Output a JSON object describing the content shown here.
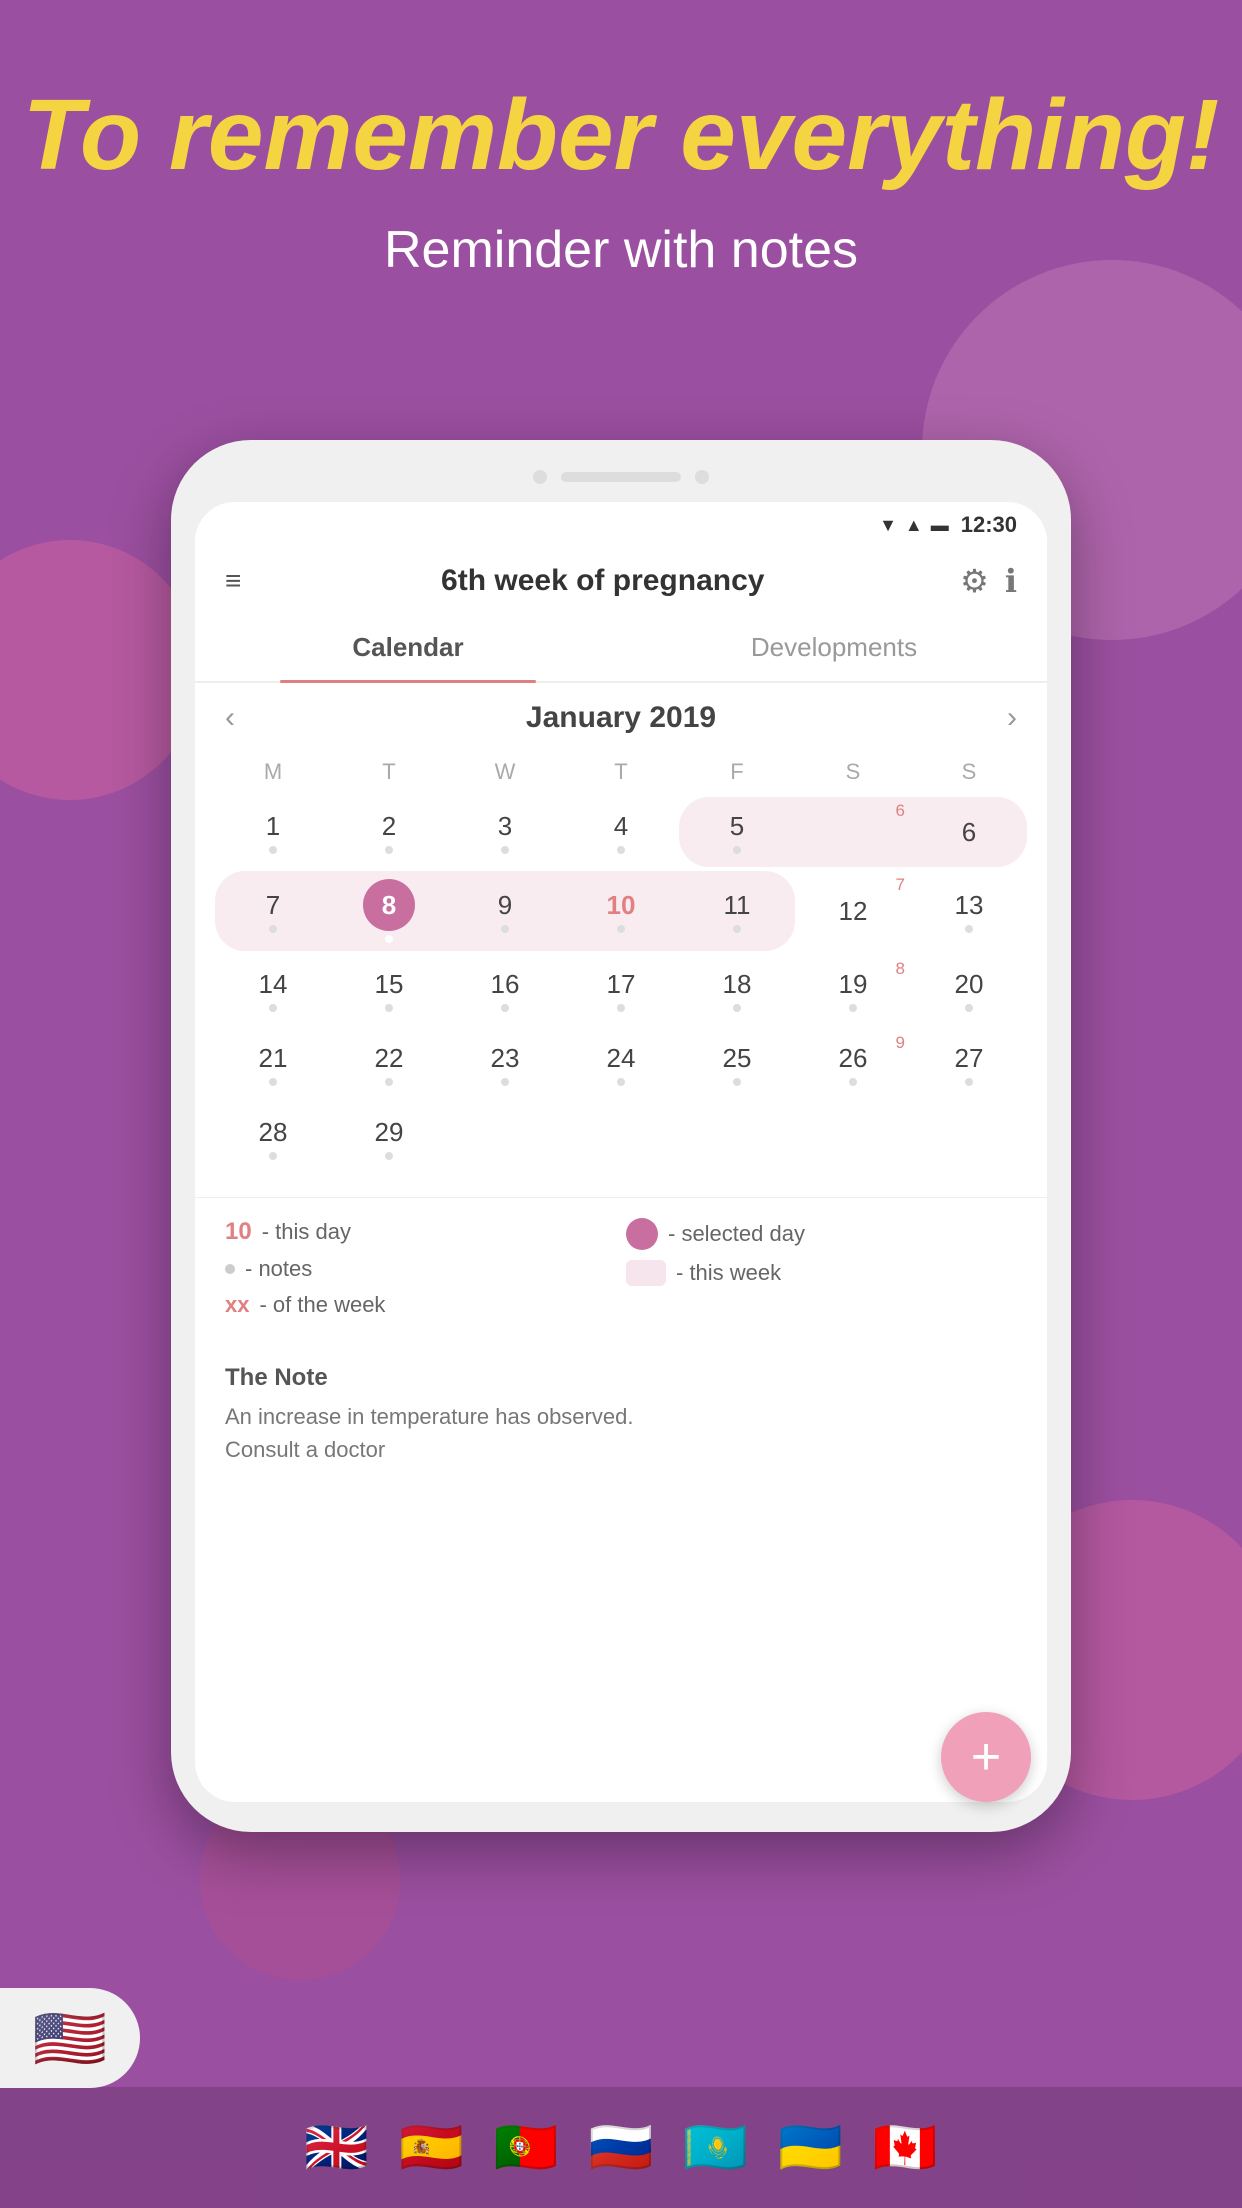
{
  "background_color": "#9b4fa0",
  "header": {
    "main_title": "To remember everything!",
    "subtitle": "Reminder with notes"
  },
  "status_bar": {
    "time": "12:30"
  },
  "app_header": {
    "title": "6th week of pregnancy"
  },
  "tabs": [
    {
      "label": "Calendar",
      "active": true
    },
    {
      "label": "Developments",
      "active": false
    }
  ],
  "calendar": {
    "month_year": "January 2019",
    "day_headers": [
      "M",
      "T",
      "W",
      "T",
      "F",
      "S",
      "S"
    ],
    "rows": [
      [
        {
          "day": "1",
          "dot": true,
          "week_num": null,
          "selected": false,
          "highlight": false,
          "today": false
        },
        {
          "day": "2",
          "dot": true,
          "week_num": null,
          "selected": false,
          "highlight": false,
          "today": false
        },
        {
          "day": "3",
          "dot": true,
          "week_num": null,
          "selected": false,
          "highlight": false,
          "today": false
        },
        {
          "day": "4",
          "dot": true,
          "week_num": null,
          "selected": false,
          "highlight": false,
          "today": false
        },
        {
          "day": "5",
          "dot": true,
          "week_num": null,
          "selected": false,
          "highlight": true,
          "today": false
        },
        {
          "day": "6",
          "dot": null,
          "week_num": "6",
          "selected": false,
          "highlight": true,
          "today": false
        },
        {
          "day": "6",
          "dot": false,
          "week_num": null,
          "selected": false,
          "highlight": true,
          "today": false
        }
      ],
      [
        {
          "day": "7",
          "dot": true,
          "week_num": null,
          "selected": false,
          "highlight": true,
          "today": false
        },
        {
          "day": "8",
          "dot": true,
          "week_num": null,
          "selected": true,
          "highlight": true,
          "today": false
        },
        {
          "day": "9",
          "dot": true,
          "week_num": null,
          "selected": false,
          "highlight": true,
          "today": false
        },
        {
          "day": "10",
          "dot": true,
          "week_num": null,
          "selected": false,
          "highlight": true,
          "today": true
        },
        {
          "day": "11",
          "dot": true,
          "week_num": null,
          "selected": false,
          "highlight": true,
          "today": false
        },
        {
          "day": "12",
          "dot": false,
          "week_num": "7",
          "selected": false,
          "highlight": false,
          "today": false
        },
        {
          "day": "13",
          "dot": true,
          "week_num": null,
          "selected": false,
          "highlight": false,
          "today": false
        }
      ],
      [
        {
          "day": "14",
          "dot": true,
          "week_num": null,
          "selected": false,
          "highlight": false,
          "today": false
        },
        {
          "day": "15",
          "dot": true,
          "week_num": null,
          "selected": false,
          "highlight": false,
          "today": false
        },
        {
          "day": "16",
          "dot": true,
          "week_num": null,
          "selected": false,
          "highlight": false,
          "today": false
        },
        {
          "day": "17",
          "dot": true,
          "week_num": null,
          "selected": false,
          "highlight": false,
          "today": false
        },
        {
          "day": "18",
          "dot": true,
          "week_num": null,
          "selected": false,
          "highlight": false,
          "today": false
        },
        {
          "day": "19",
          "dot": true,
          "week_num": "8",
          "selected": false,
          "highlight": false,
          "today": false
        },
        {
          "day": "20",
          "dot": true,
          "week_num": null,
          "selected": false,
          "highlight": false,
          "today": false
        }
      ],
      [
        {
          "day": "21",
          "dot": true,
          "week_num": null,
          "selected": false,
          "highlight": false,
          "today": false
        },
        {
          "day": "22",
          "dot": true,
          "week_num": null,
          "selected": false,
          "highlight": false,
          "today": false
        },
        {
          "day": "23",
          "dot": true,
          "week_num": null,
          "selected": false,
          "highlight": false,
          "today": false
        },
        {
          "day": "24",
          "dot": true,
          "week_num": null,
          "selected": false,
          "highlight": false,
          "today": false
        },
        {
          "day": "25",
          "dot": true,
          "week_num": null,
          "selected": false,
          "highlight": false,
          "today": false
        },
        {
          "day": "26",
          "dot": true,
          "week_num": "9",
          "selected": false,
          "highlight": false,
          "today": false
        },
        {
          "day": "27",
          "dot": true,
          "week_num": null,
          "selected": false,
          "highlight": false,
          "today": false
        }
      ],
      [
        {
          "day": "28",
          "dot": true,
          "week_num": null,
          "selected": false,
          "highlight": false,
          "today": false
        },
        {
          "day": "29",
          "dot": true,
          "week_num": null,
          "selected": false,
          "highlight": false,
          "today": false
        },
        {
          "day": "",
          "dot": false,
          "week_num": null,
          "selected": false,
          "highlight": false,
          "today": false
        },
        {
          "day": "",
          "dot": false,
          "week_num": null,
          "selected": false,
          "highlight": false,
          "today": false
        },
        {
          "day": "",
          "dot": false,
          "week_num": null,
          "selected": false,
          "highlight": false,
          "today": false
        },
        {
          "day": "",
          "dot": false,
          "week_num": null,
          "selected": false,
          "highlight": false,
          "today": false
        },
        {
          "day": "",
          "dot": false,
          "week_num": null,
          "selected": false,
          "highlight": false,
          "today": false
        }
      ]
    ]
  },
  "legend": {
    "today_num": "10",
    "today_label": "- this day",
    "dot_label": "- notes",
    "week_label": "- of the week",
    "week_prefix": "xx",
    "selected_label": "- selected day",
    "this_week_label": "- this week"
  },
  "note": {
    "title": "The Note",
    "text": "An increase in temperature has observed.\nConsult a doctor"
  },
  "fab": {
    "label": "+"
  },
  "flags": [
    "🇬🇧",
    "🇪🇸",
    "🇵🇹",
    "🇷🇺",
    "🇰🇿",
    "🇺🇦",
    "🇨🇦"
  ],
  "us_flag": "🇺🇸"
}
